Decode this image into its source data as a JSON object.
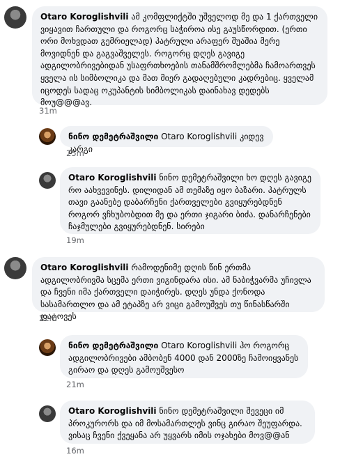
{
  "comments": [
    {
      "author": "Otaro Koroglishvili",
      "text": " ამ კომფლიქტში უშველოდ მე და 1 ქართველი ვიყავით ჩართული და როგორც საჭიროა ისე გაუსწორდით. (ერთი ორი მოხვდათ გემრიელად) პატრული არაფერ შუაშია მერე მოვიდნენ და გაგვაშველეს. როგორც დღეს გავიგე ადგილობრივებიდან უსაფრთხოების თანამშრომლებმა ჩამოართვეს ყველა ის სიმბოლიკა და მათ მიერ გადაღებული კადრებიც. ყველამ იცოდეს სადაც ოკუპანტის სიმბოლიკას დაინახავ დედებს მოუ@@@ავ.",
      "time": "31m"
    },
    {
      "author": "ნინო დემეტრაშვილი",
      "text": " Otaro Koroglishvili კიდევ კარგი",
      "time": "25m"
    },
    {
      "author": "Otaro Koroglishvili",
      "text": " ნინო დემეტრაშვილი ხო დღეს გავიგე რო აახვევინეს. დილიდან ამ თემაზე იყო ბაზარი. პატრულს თავი გაანებე დაბარჩენი ქართველები გვიყურებდნენ როგორ ვჩხუბობდით მე და ერთი ჯიგარი ბიძა. დანარჩენები ჩაჯმულები გვიყურებდნენ. სირები",
      "time": "19m"
    },
    {
      "author": "Otaro Koroglishvili",
      "text": " რამოდენიმე დღის წინ ერთმა ადგილობრივმა სცემა ერთი ვიგინდარა ისი. ამ ნაბიჭვარმა უჩივლა და ჩვენი იმა ქართველი დაიჭირეს. დღეს უნდა ქონოდა სასამართლო და ამ ეტაპზე არ ვიცი გამოუშვეს თუ წინასწარში დატოვეს",
      "time": "22m"
    },
    {
      "author": "ნინო დემეტრაშვილი",
      "text": " Otaro Koroglishvili ჰო როგორც ადგილობრივები ამბობენ 4000 დან 2000ზე ჩამოიყვანეს გირაო და დღეს გამოუშვესო",
      "time": "21m"
    },
    {
      "author": "Otaro Koroglishvili",
      "text": " ნინო დემეტრაშვილი შევეცი იმ პროკურორს და იმ მოსამართლეს ვინც გირაო შეუფარდა. ვისაც ჩვენი ქვეყანა არ უყვარს იმის ოჯახები მოვ@@ან",
      "time": "16m"
    }
  ]
}
